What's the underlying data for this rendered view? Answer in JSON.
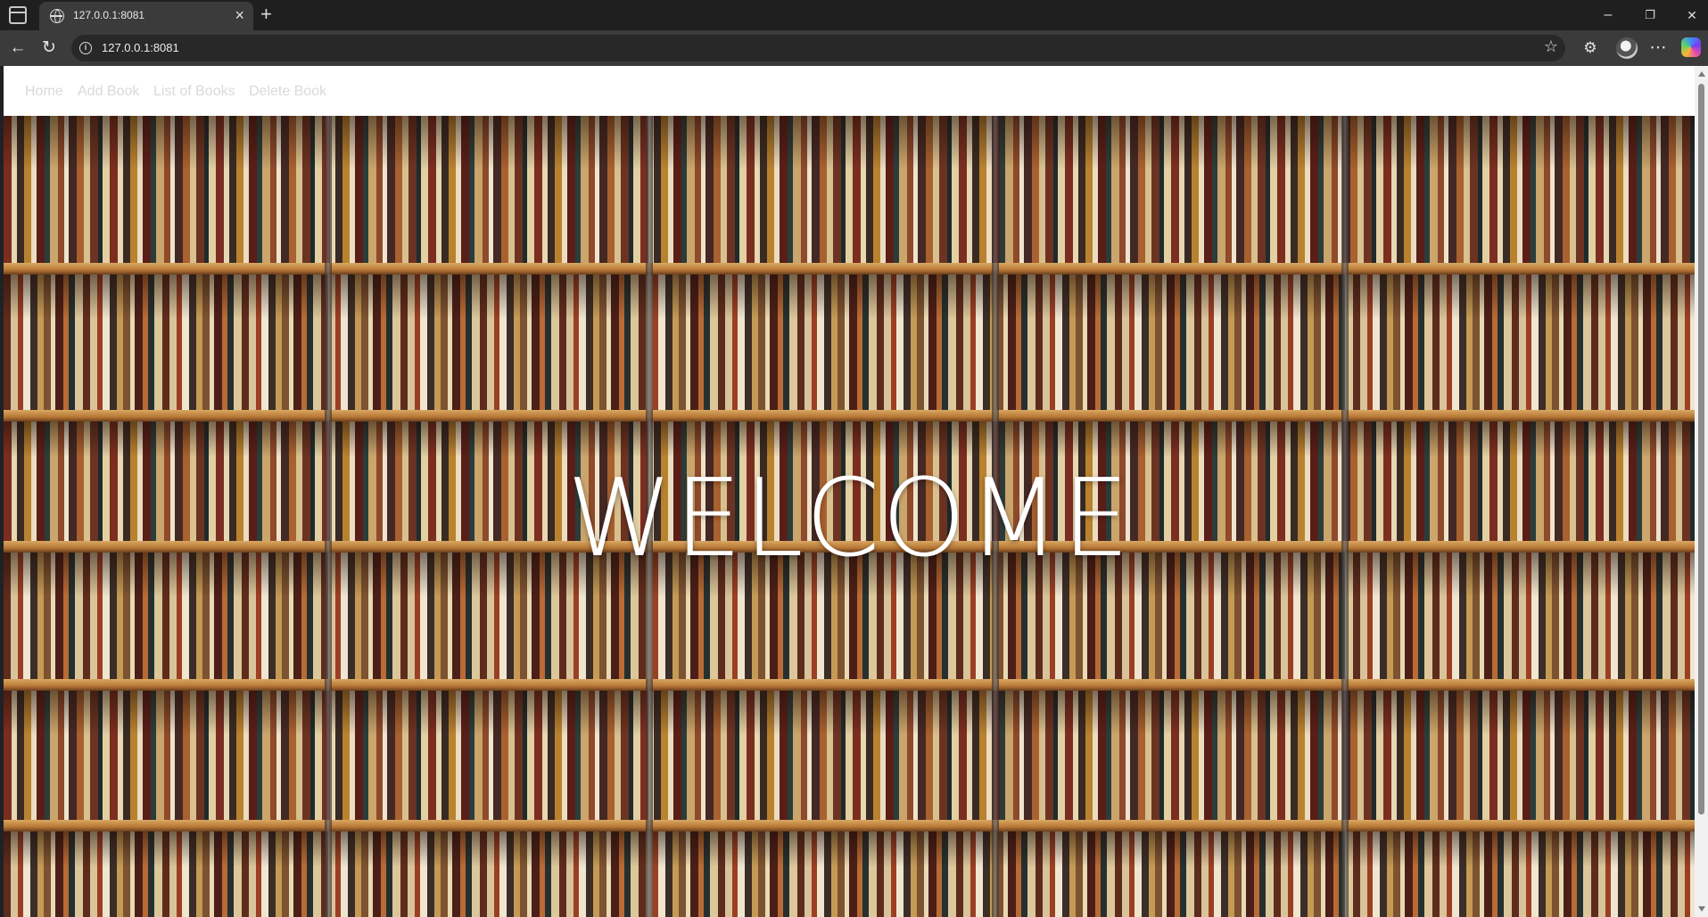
{
  "browser": {
    "tab": {
      "title": "127.0.0.1:8081",
      "icon": "globe-icon"
    },
    "address": {
      "url": "127.0.0.1:8081"
    },
    "window_controls": {
      "minimize": "–",
      "restore": "❐",
      "close": "✕"
    }
  },
  "page": {
    "nav": {
      "items": [
        {
          "label": "Home"
        },
        {
          "label": "Add Book"
        },
        {
          "label": "List of Books"
        },
        {
          "label": "Delete Book"
        }
      ],
      "link_color": "#d9d9d9"
    },
    "hero": {
      "heading": "WELCOME",
      "background": "bookshelf-photo"
    }
  },
  "colors": {
    "chrome_dark": "#1f1f1f",
    "chrome_toolbar": "#3b3b3b",
    "navbar_bg": "#ffffff",
    "heading_color": "#ffffff"
  }
}
